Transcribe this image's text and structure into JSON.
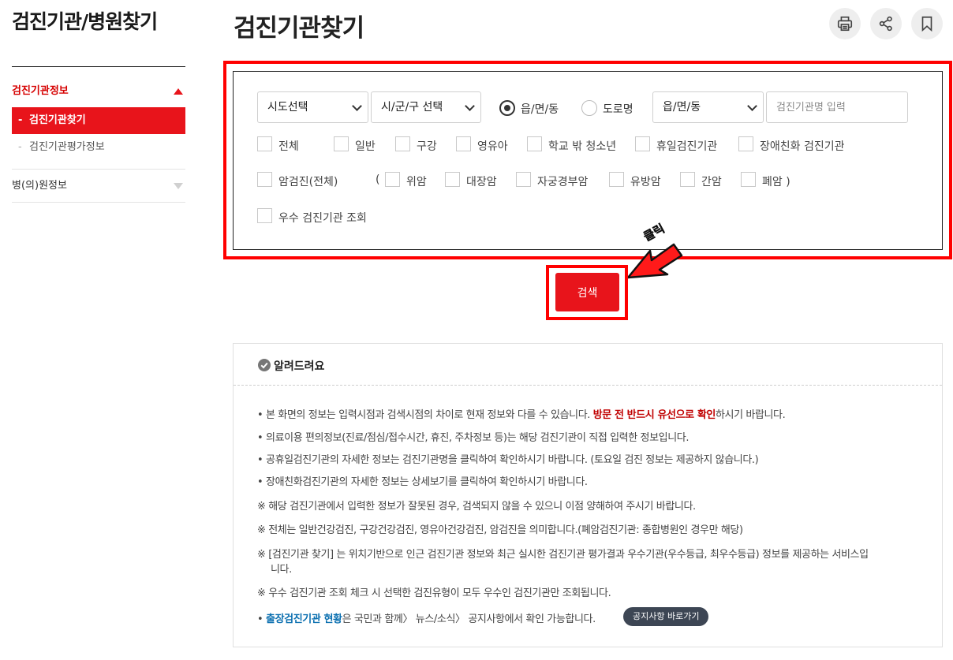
{
  "sidebar": {
    "title": "검진기관/병원찾기",
    "section1": "검진기관정보",
    "items": [
      {
        "label": "검진기관찾기",
        "active": true
      },
      {
        "label": "검진기관평가정보",
        "active": false
      }
    ],
    "section2": "병(의)원정보"
  },
  "header": {
    "title": "검진기관찾기",
    "icons": [
      "print-icon",
      "share-icon",
      "bookmark-icon"
    ]
  },
  "search": {
    "sido_select": "시도선택",
    "sigungu_select": "시/군/구 선택",
    "radio_eupmyeon": "읍/면/동",
    "radio_road": "도로명",
    "eupmyeon_select": "읍/면/동",
    "name_placeholder": "검진기관명 입력",
    "row1": [
      "전체",
      "일반",
      "구강",
      "영유아",
      "학교 밖 청소년",
      "휴일검진기관",
      "장애친화 검진기관"
    ],
    "cancer_all": "암검진(전체)",
    "paren_open": "(",
    "cancer": [
      "위암",
      "대장암",
      "자궁경부암",
      "유방암",
      "간암",
      "폐암 )"
    ],
    "excellent": "우수 검진기관 조회",
    "button": "검색",
    "annotation": "클릭"
  },
  "notice": {
    "title": "알려드려요",
    "lines": [
      {
        "bullet": "•",
        "pre": "본 화면의 정보는 입력시점과 검색시점의 차이로 현재 정보와 다를 수 있습니다. ",
        "highlight": "방문 전 반드시 유선으로 확인",
        "post": "하시기 바랍니다."
      },
      {
        "bullet": "•",
        "text": "의료이용 편의정보(진료/점심/접수시간, 휴진, 주차정보 등)는 해당 검진기관이 직접 입력한 정보입니다."
      },
      {
        "bullet": "•",
        "text": "공휴일검진기관의 자세한 정보는 검진기관명을 클릭하여 확인하시기 바랍니다. (토요일 검진 정보는 제공하지 않습니다.)"
      },
      {
        "bullet": "•",
        "text": "장애친화검진기관의 자세한 정보는 상세보기를 클릭하여 확인하시기 바랍니다."
      },
      {
        "bullet": "※",
        "text": "해당 검진기관에서 입력한 정보가 잘못된 경우, 검색되지 않을 수 있으니 이점 양해하여 주시기 바랍니다."
      },
      {
        "bullet": "※",
        "text": "전체는 일반건강검진, 구강건강검진, 영유아건강검진, 암검진을 의미합니다.(폐암검진기관: 종합병원인 경우만 해당)"
      },
      {
        "bullet": "※",
        "text": "[검진기관 찾기] 는 위치기반으로 인근 검진기관 정보와 최근 실시한 검진기관 평가결과 우수기관(우수등급, 최우수등급) 정보를 제공하는 서비스입",
        "cont": "니다."
      },
      {
        "bullet": "※",
        "text": "우수 검진기관 조회 체크 시 선택한 검진유형이 모두 우수인 검진기관만 조회됩니다."
      },
      {
        "bullet": "•",
        "link": "출장검진기관 현황",
        "post": "은 국민과 함께〉 뉴스/소식〉 공지사항에서 확인 가능합니다."
      }
    ],
    "pill": "공지사항 바로가기"
  },
  "colors": {
    "accent": "#e8141b",
    "annotation": "#ff0000"
  }
}
